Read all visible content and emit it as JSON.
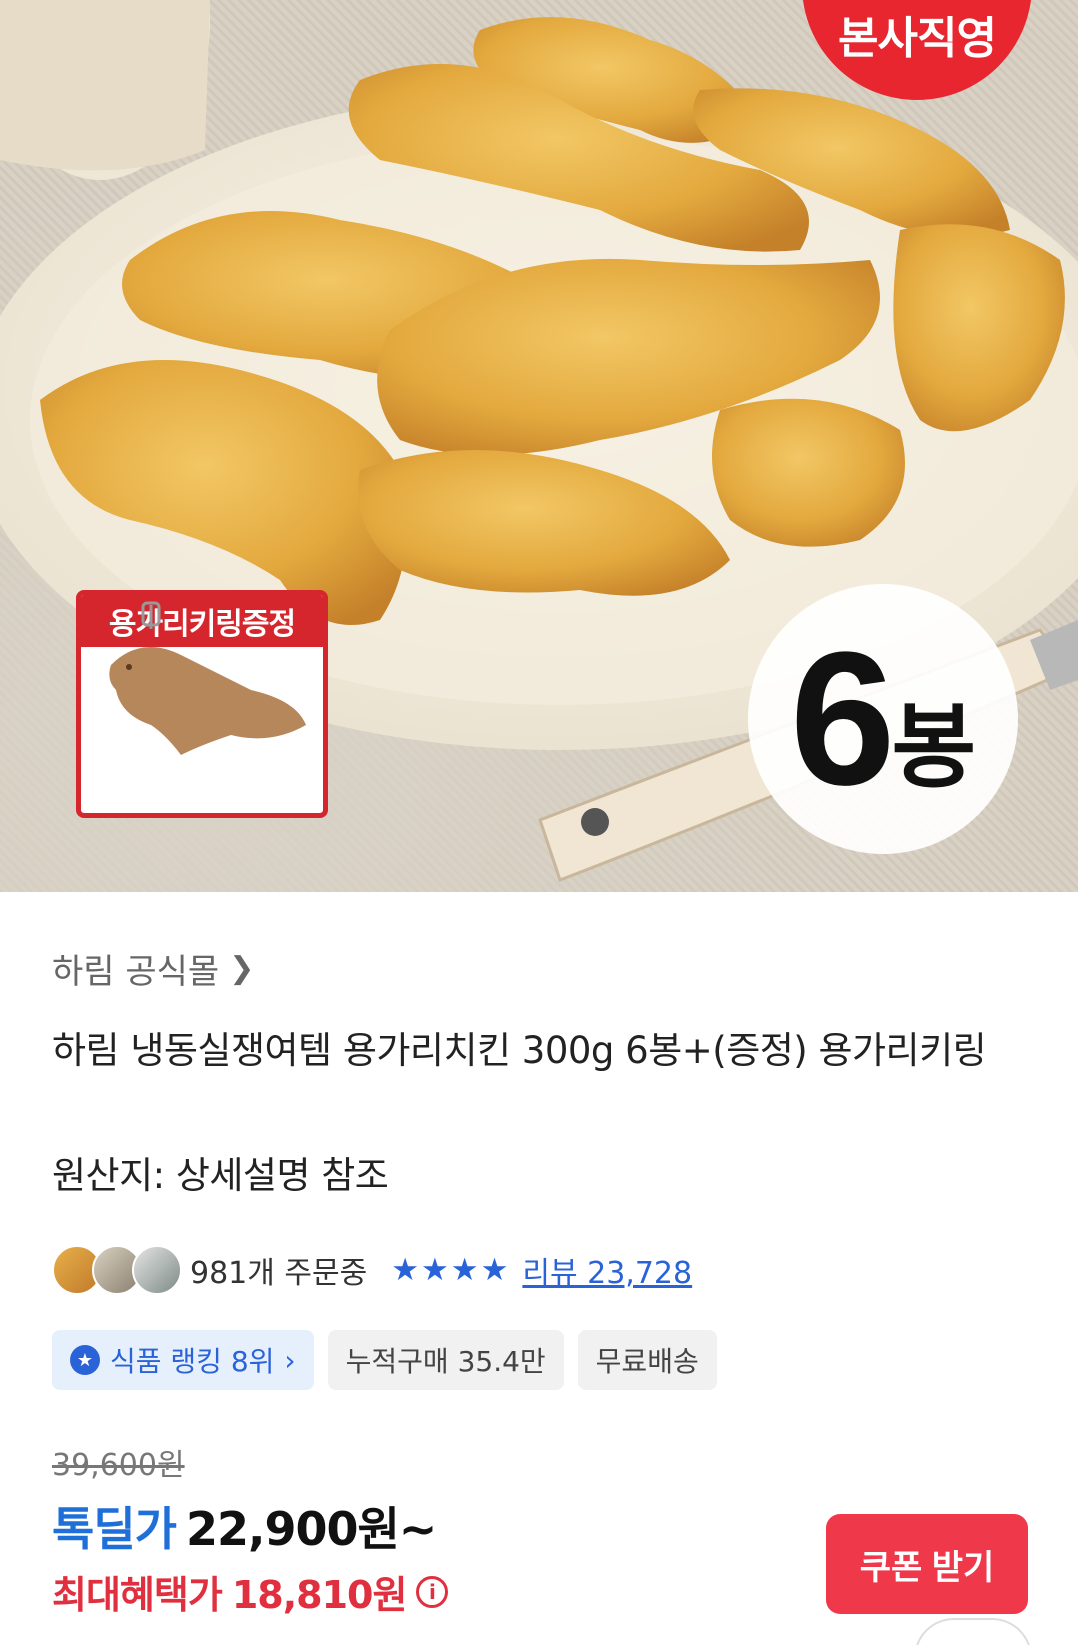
{
  "hero": {
    "badge_direct": "본사직영",
    "gift_title": "용가리키링증정",
    "count_number": "6",
    "count_unit": "봉"
  },
  "product": {
    "store_name": "하림 공식몰",
    "title": "하림 냉동실쟁여템 용가리치킨 300g 6봉+(증정) 용가리키링",
    "origin": "원산지: 상세설명 참조",
    "orders": "981개 주문중",
    "rating_stars": 4,
    "review_text": "리뷰 23,728"
  },
  "chips": {
    "rank": "식품 랭킹 8위",
    "cumulative": "누적구매 35.4만",
    "shipping": "무료배송"
  },
  "price": {
    "original": "39,600원",
    "deal_label": "톡딜가",
    "deal_price": "22,900원~",
    "max_label": "최대혜택가",
    "max_price": "18,810원"
  },
  "actions": {
    "coupon": "쿠폰 받기"
  },
  "colors": {
    "accent_blue": "#2a63d8",
    "deal_blue": "#1f6fd9",
    "accent_red": "#e0303f",
    "coupon_red": "#f0384b",
    "badge_red": "#e8262f"
  }
}
